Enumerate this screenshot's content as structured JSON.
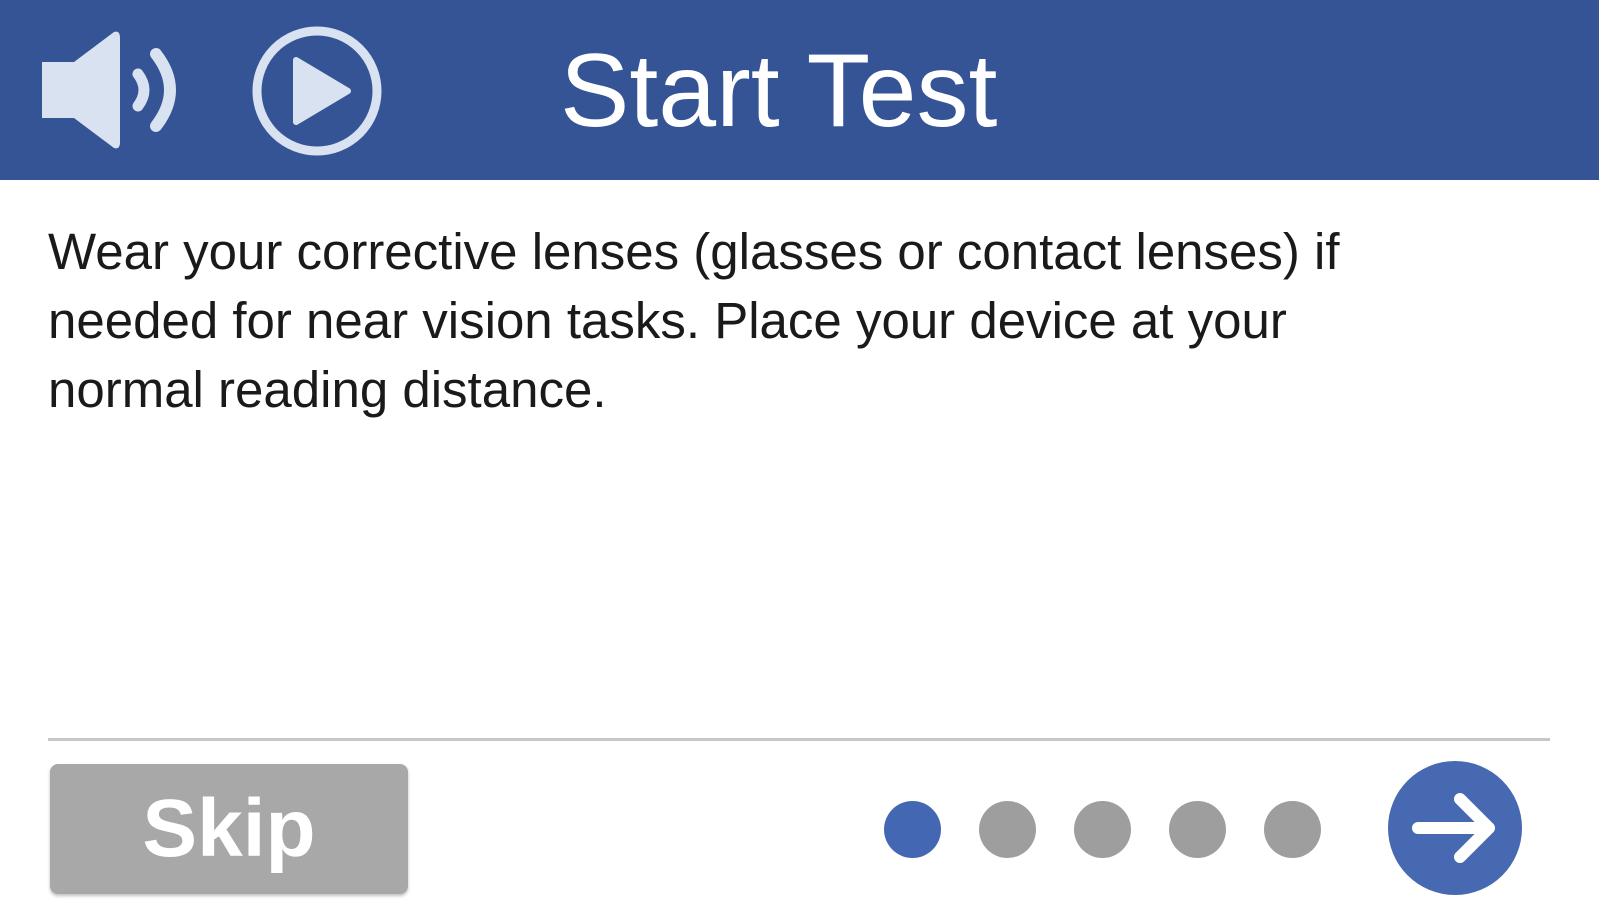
{
  "header": {
    "title": "Start Test",
    "background_color": "#355496",
    "audio_icon": "speaker-icon",
    "play_icon": "play-circle-icon"
  },
  "main": {
    "instructions": "Wear your corrective lenses (glasses or contact lenses) if\nneeded for near vision tasks.  Place your device at your\nnormal reading distance."
  },
  "footer": {
    "skip_label": "Skip",
    "pager": {
      "total_pages": 5,
      "current_page": 1,
      "active_color": "#4367b2",
      "inactive_color": "#9e9e9e"
    },
    "next_icon": "arrow-right-icon",
    "next_color": "#4769b1"
  }
}
